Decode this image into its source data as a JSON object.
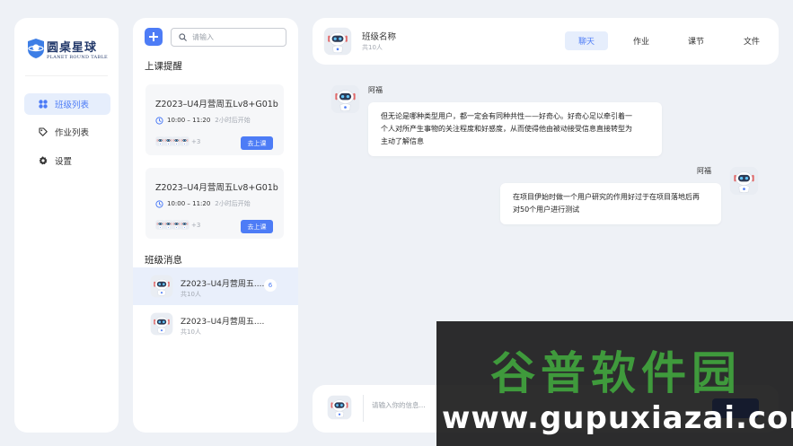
{
  "sidebar": {
    "logo_title": "圆桌星球",
    "logo_subtitle": "PLANET ROUND TABLE",
    "items": [
      {
        "label": "班级列表",
        "icon": "grid-icon",
        "active": true
      },
      {
        "label": "作业列表",
        "icon": "tag-icon",
        "active": false
      },
      {
        "label": "设置",
        "icon": "gear-icon",
        "active": false
      }
    ]
  },
  "middle": {
    "search_placeholder": "请输入",
    "reminders_title": "上课提醒",
    "reminders": [
      {
        "title": "Z2023–U4月营周五Lv8+G01b",
        "time": "10:00 – 11:20",
        "ago": "2小时后开始",
        "more": "+3",
        "button": "去上课"
      },
      {
        "title": "Z2023–U4月营周五Lv8+G01b",
        "time": "10:00 – 11:20",
        "ago": "2小时后开始",
        "more": "+3",
        "button": "去上课"
      }
    ],
    "messages_title": "班级消息",
    "messages": [
      {
        "name": "Z2023–U4月营周五....",
        "count": "共10人",
        "unread": "6"
      },
      {
        "name": "Z2023–U4月营周五....",
        "count": "共10人"
      }
    ]
  },
  "chat": {
    "class_name": "班级名称",
    "member_count": "共10人",
    "tabs": [
      "聊天",
      "作业",
      "课节",
      "文件"
    ],
    "active_tab": "聊天",
    "messages": [
      {
        "sender": "阿福",
        "side": "left",
        "lines": [
          "但无论是哪种类型用户，都一定会有同种共性——好奇心。好奇心足以牵引着一",
          "个人对所产生事物的关注程度和好感度，从而使得他由被动接受信息直接转型为",
          "主动了解信息"
        ]
      },
      {
        "sender": "阿福",
        "side": "right",
        "lines": [
          "在项目伊始时做一个用户研究的作用好过于在项目落地后再",
          "对50个用户进行测试"
        ]
      }
    ],
    "input_placeholder": "请输入你的信息..."
  },
  "watermark": {
    "cn": "谷普软件园",
    "en": "www.gupuxiazai.com"
  },
  "colors": {
    "accent": "#4d7cf6",
    "background": "#eef1f6",
    "active_nav_bg": "#e6eefc",
    "watermark_green": "#3f9a3c"
  }
}
